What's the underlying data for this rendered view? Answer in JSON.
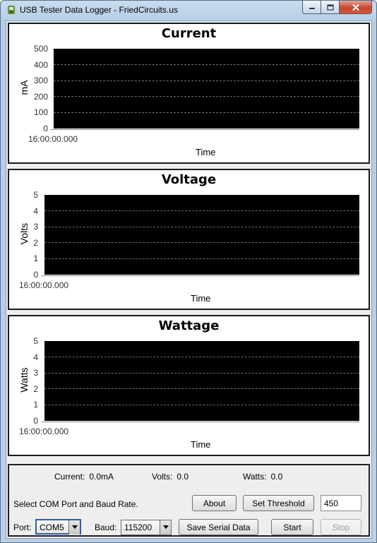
{
  "window": {
    "title": "USB Tester Data Logger - FriedCircuits.us",
    "icon": "usb-app-icon",
    "controls": [
      "minimize-icon",
      "maximize-icon",
      "close-icon"
    ]
  },
  "charts": [
    {
      "title": "Current",
      "ylabel": "mA",
      "xlabel": "Time",
      "yticks": [
        "500",
        "400",
        "300",
        "200",
        "100",
        "0"
      ],
      "xtick": "16:00:00.000"
    },
    {
      "title": "Voltage",
      "ylabel": "Volts",
      "xlabel": "Time",
      "yticks": [
        "5",
        "4",
        "3",
        "2",
        "1",
        "0"
      ],
      "xtick": "16:00:00.000"
    },
    {
      "title": "Wattage",
      "ylabel": "Watts",
      "xlabel": "Time",
      "yticks": [
        "5",
        "4",
        "3",
        "2",
        "1",
        "0"
      ],
      "xtick": "16:00:00.000"
    }
  ],
  "chart_data": [
    {
      "type": "line",
      "title": "Current",
      "xlabel": "Time",
      "ylabel": "mA",
      "ylim": [
        0,
        500
      ],
      "x": [],
      "series": [],
      "grid": true,
      "background": "#000000"
    },
    {
      "type": "line",
      "title": "Voltage",
      "xlabel": "Time",
      "ylabel": "Volts",
      "ylim": [
        0,
        5
      ],
      "x": [],
      "series": [],
      "grid": true,
      "background": "#000000"
    },
    {
      "type": "line",
      "title": "Wattage",
      "xlabel": "Time",
      "ylabel": "Watts",
      "ylim": [
        0,
        5
      ],
      "x": [],
      "series": [],
      "grid": true,
      "background": "#000000"
    }
  ],
  "readouts": {
    "current_label": "Current:",
    "current_value": "0.0mA",
    "volts_label": "Volts:",
    "volts_value": "0.0",
    "watts_label": "Watts:",
    "watts_value": "0.0"
  },
  "controls": {
    "status": "Select COM Port and Baud Rate.",
    "about": "About",
    "set_threshold": "Set Threshold",
    "threshold_value": "450",
    "port_label": "Port:",
    "port_value": "COM5",
    "baud_label": "Baud:",
    "baud_value": "115200",
    "save_serial": "Save Serial Data",
    "start": "Start",
    "stop": "Stop"
  }
}
